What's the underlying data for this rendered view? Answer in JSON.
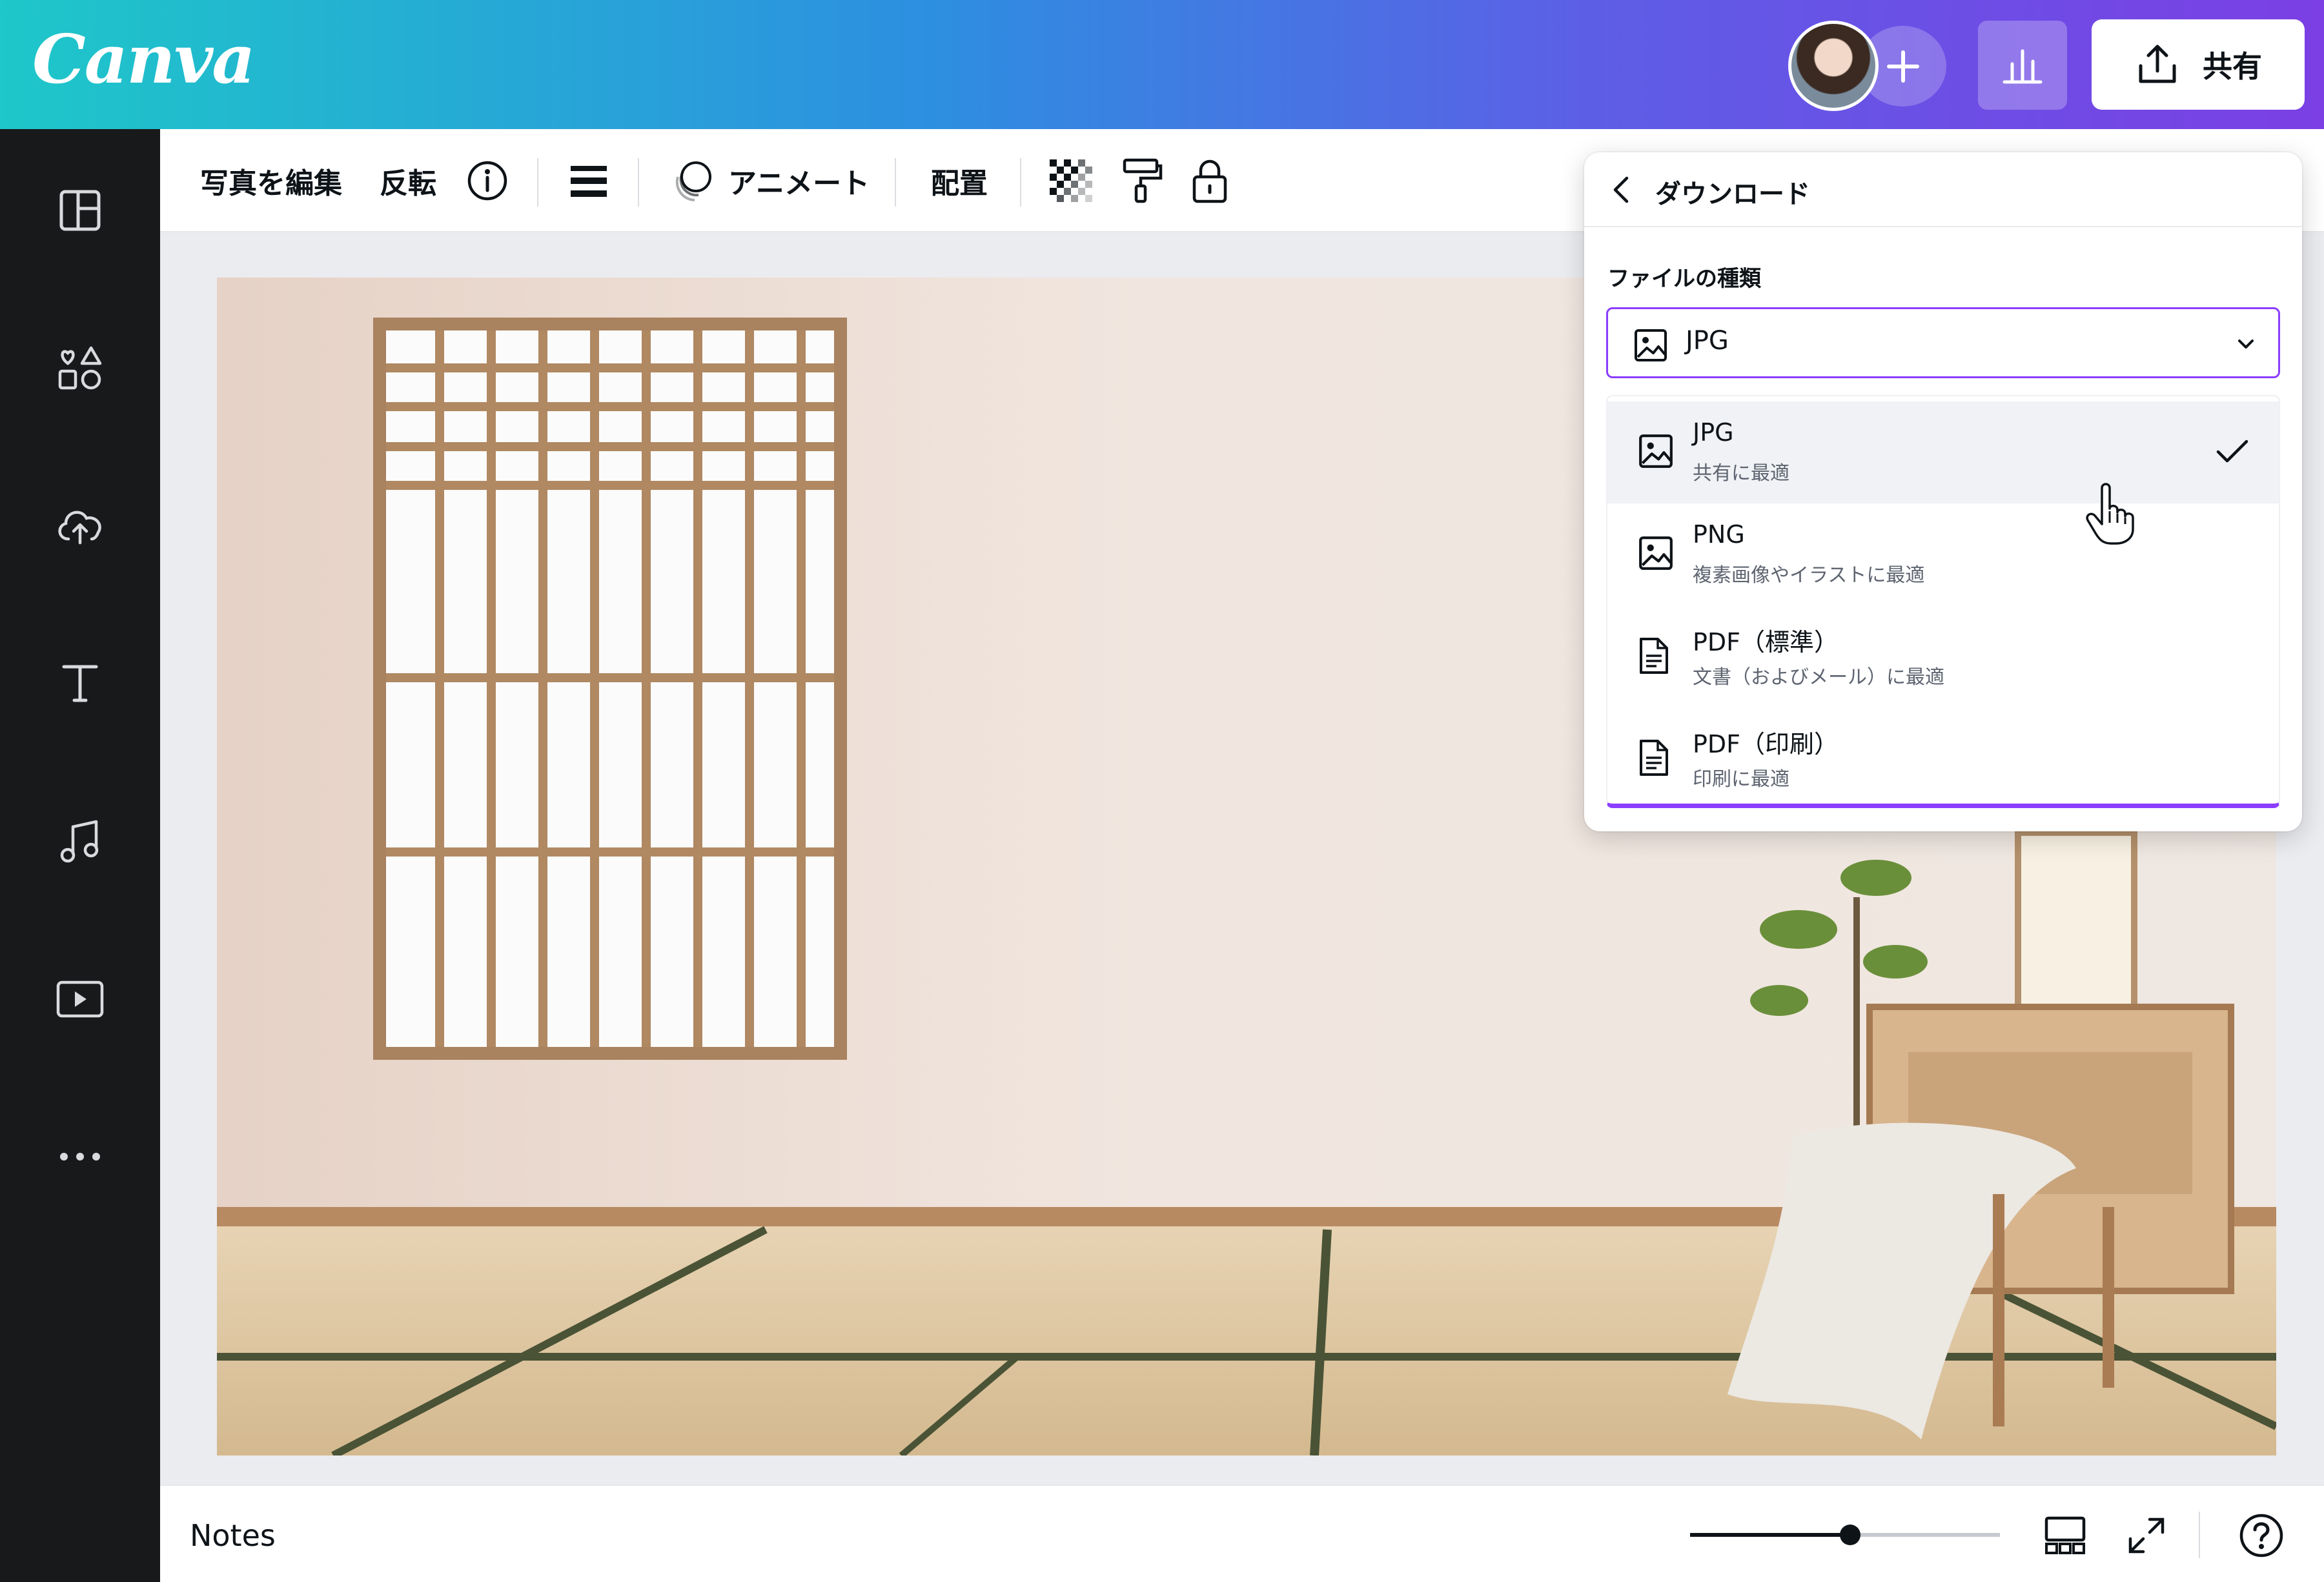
{
  "app": {
    "logo": "Canva"
  },
  "header": {
    "share_label": "共有"
  },
  "toolbar": {
    "edit_photo": "写真を編集",
    "flip": "反転",
    "animate": "アニメート",
    "position": "配置"
  },
  "sidebar": {
    "items": [
      "layout-icon",
      "elements-icon",
      "upload-icon",
      "text-icon",
      "music-icon",
      "video-icon",
      "more-icon"
    ]
  },
  "bottombar": {
    "notes": "Notes"
  },
  "download_panel": {
    "title": "ダウンロード",
    "file_type_label": "ファイルの種類",
    "selected_value": "JPG",
    "options": [
      {
        "title": "JPG",
        "subtitle": "共有に最適",
        "icon": "image-icon",
        "selected": true
      },
      {
        "title": "PNG",
        "subtitle": "複素画像やイラストに最適",
        "icon": "image-icon",
        "selected": false
      },
      {
        "title": "PDF（標準）",
        "subtitle": "文書（およびメール）に最適",
        "icon": "document-icon",
        "selected": false
      },
      {
        "title": "PDF（印刷）",
        "subtitle": "印刷に最適",
        "icon": "document-icon",
        "selected": false
      }
    ]
  },
  "colors": {
    "accent": "#8b3dff",
    "sidebar": "#18191b"
  }
}
